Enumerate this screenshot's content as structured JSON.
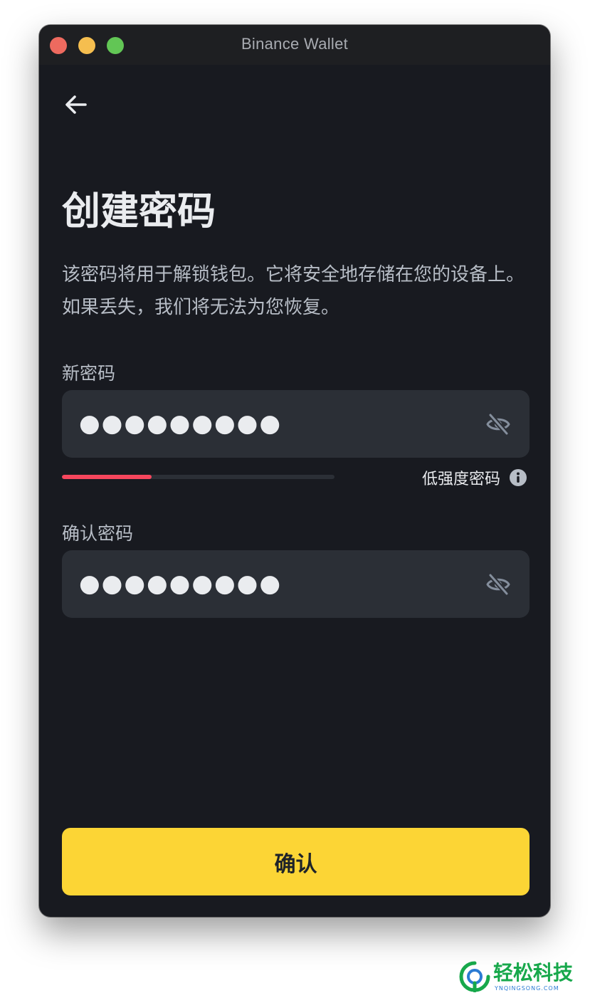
{
  "window": {
    "title": "Binance Wallet"
  },
  "page": {
    "title": "创建密码",
    "description": "该密码将用于解锁钱包。它将安全地存储在您的设备上。如果丢失，我们将无法为您恢复。"
  },
  "new_password": {
    "label": "新密码",
    "value": "●●●●●●●●●",
    "visibility_icon": "eye-slash-icon"
  },
  "strength": {
    "label": "低强度密码",
    "level_fraction": 0.33,
    "color": "#f6465d",
    "info_icon": "info-icon"
  },
  "confirm_password": {
    "label": "确认密码",
    "value": "●●●●●●●●●",
    "visibility_icon": "eye-slash-icon"
  },
  "actions": {
    "confirm_label": "确认",
    "back_icon": "arrow-left-icon"
  },
  "colors": {
    "accent": "#fcd535",
    "background": "#181a20",
    "input_bg": "#2b2f36",
    "strength_weak": "#f6465d"
  },
  "watermark": {
    "name": "轻松科技",
    "url_text": "YNQINGSONG.COM"
  }
}
